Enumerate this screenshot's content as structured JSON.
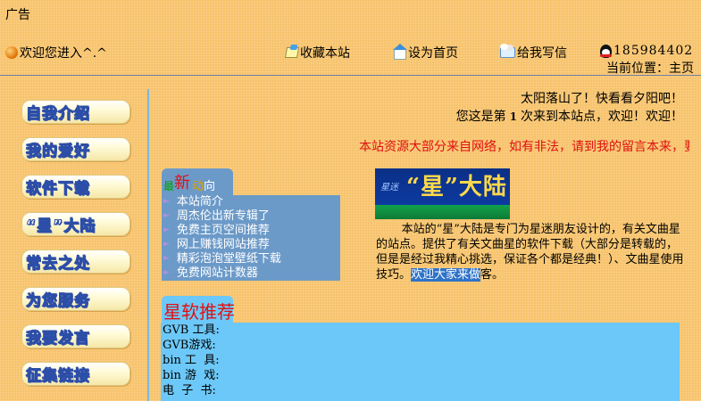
{
  "header": {
    "ad_label": "广告",
    "welcome": "欢迎您进入^.^",
    "bookmark": "收藏本站",
    "set_home": "设为首页",
    "write_me": "给我写信",
    "qq_number": "185984402",
    "location": "当前位置：主页"
  },
  "sidebar": {
    "items": [
      {
        "label": "自我介绍"
      },
      {
        "label": "我的爱好"
      },
      {
        "label": "软件下载"
      },
      {
        "label": "“星”大陆"
      },
      {
        "label": "常去之处"
      },
      {
        "label": "为您服务"
      },
      {
        "label": "我要发言"
      },
      {
        "label": "征集链接"
      }
    ]
  },
  "greeting": {
    "line1": "太阳落山了！快看看夕阳吧！",
    "visit_prefix": "您这是第",
    "visit_count": "1",
    "visit_suffix": "次来到本站点，欢迎！欢迎！"
  },
  "marquee": "本站资源大部分来自网络，如有非法，请到我的留言本来，要",
  "news": {
    "title_chars": [
      {
        "char": "最",
        "color": "#00a000"
      },
      {
        "char": "新",
        "color": "#e01010"
      },
      {
        "char": "动",
        "color": "#e0a000"
      },
      {
        "char": "向",
        "color": "#ffffff"
      }
    ],
    "items": [
      "本站简介",
      "周杰伦出新专辑了",
      "免费主页空间推荐",
      "网上赚钱网站推荐",
      "精彩泡泡堂壁纸下载",
      "免费网站计数器"
    ]
  },
  "banner": {
    "title": "“星”大陆",
    "script": "星迷"
  },
  "intro": {
    "text": "本站的“星”大陆是专门为星迷朋友设计的，有关文曲星的站点。提供了有关文曲星的软件下载（大部分是转载的，但是是经过我精心挑选，保证各个都是经典！）、文曲星使用技巧。",
    "highlight": "欢迎大家来做",
    "tail": "客。"
  },
  "software": {
    "title": "星软推荐",
    "rows": [
      "GVB 工具:",
      "GVB游戏:",
      "bin 工  具:",
      "bin 游  戏:",
      "电  子  书:"
    ]
  },
  "colors": {
    "page_bg": "#f7c36b",
    "news_bg": "#6c9ac8",
    "soft_bg": "#6cc8f8",
    "marquee": "#e01010",
    "highlight": "#2f73c8"
  }
}
